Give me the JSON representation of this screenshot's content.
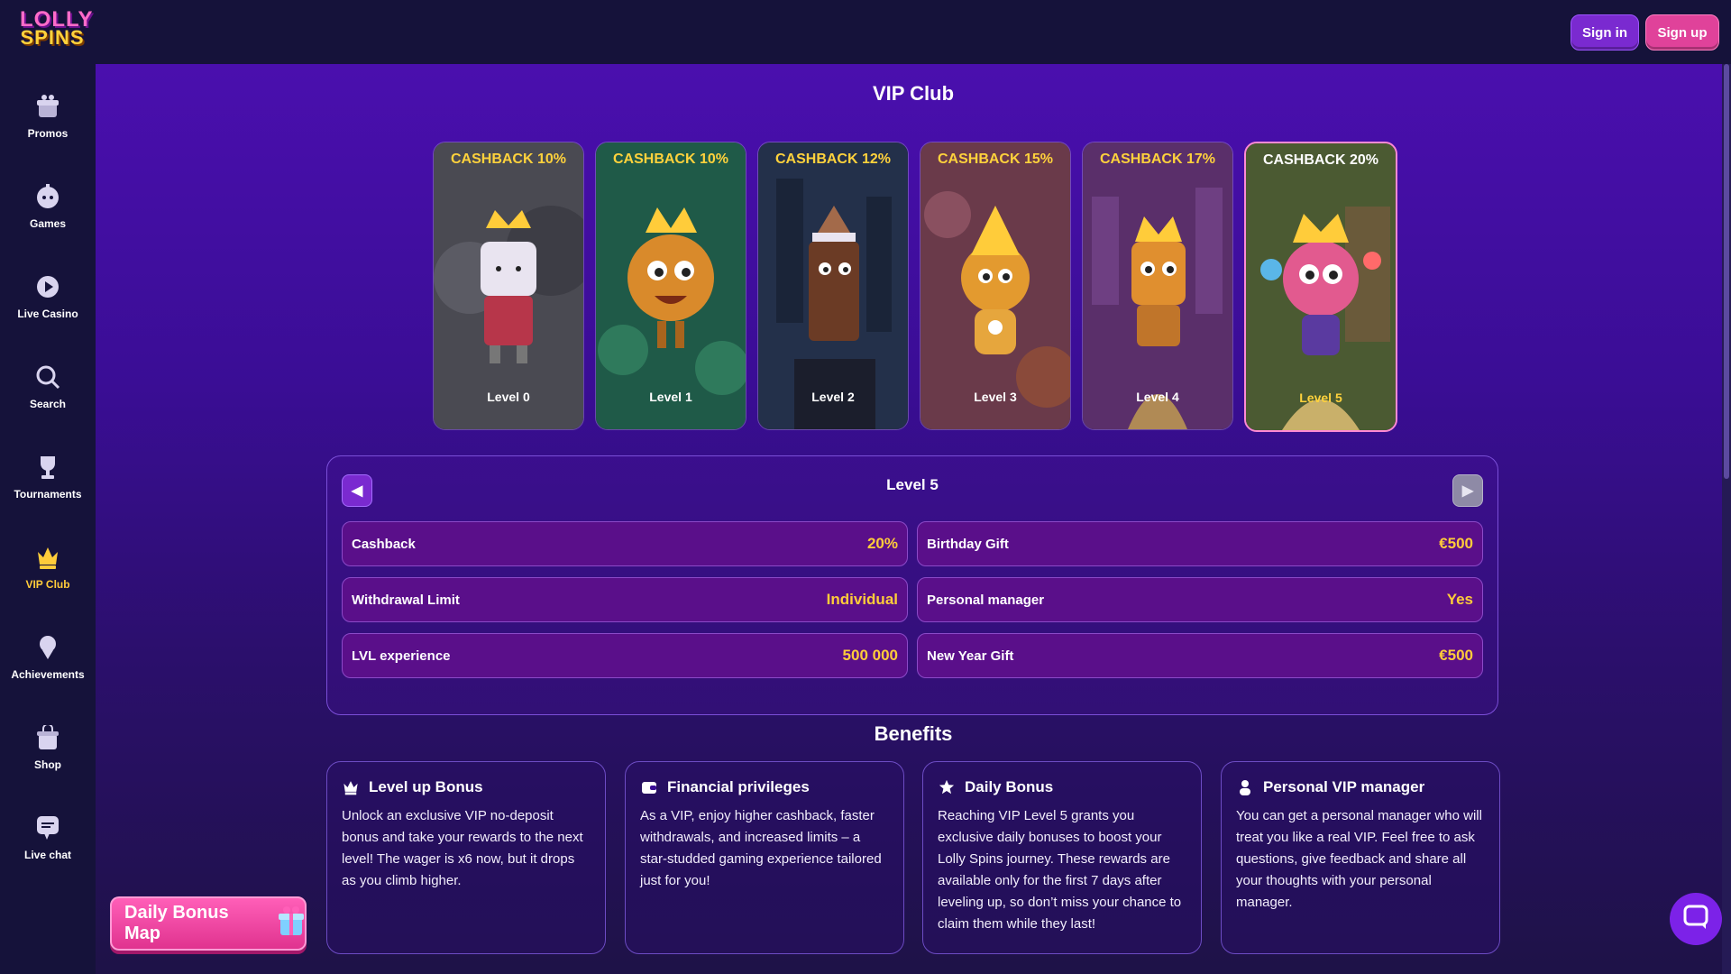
{
  "brand": {
    "line1": "LOLLY",
    "line2": "SPINS"
  },
  "header": {
    "signin_label": "Sign in",
    "signup_label": "Sign up"
  },
  "sidebar": {
    "items": [
      {
        "label": "Promos",
        "icon": "gift-icon"
      },
      {
        "label": "Games",
        "icon": "gamepad-icon"
      },
      {
        "label": "Live Casino",
        "icon": "play-icon"
      },
      {
        "label": "Search",
        "icon": "search-icon"
      },
      {
        "label": "Tournaments",
        "icon": "trophy-icon"
      },
      {
        "label": "VIP Club",
        "icon": "crown-icon",
        "active": true
      },
      {
        "label": "Achievements",
        "icon": "medal-icon"
      },
      {
        "label": "Shop",
        "icon": "shop-icon"
      },
      {
        "label": "Live chat",
        "icon": "chat-icon"
      }
    ]
  },
  "vip": {
    "title": "VIP Club",
    "levels": [
      {
        "cashback": "CASHBACK 10%",
        "label": "Level 0",
        "bg": "#4a4a52"
      },
      {
        "cashback": "CASHBACK 10%",
        "label": "Level 1",
        "bg": "#1f5a48"
      },
      {
        "cashback": "CASHBACK 12%",
        "label": "Level 2",
        "bg": "#23304a"
      },
      {
        "cashback": "CASHBACK 15%",
        "label": "Level 3",
        "bg": "#6a3a4a"
      },
      {
        "cashback": "CASHBACK 17%",
        "label": "Level 4",
        "bg": "#5a2f6a"
      },
      {
        "cashback": "CASHBACK 20%",
        "label": "Level 5",
        "bg": "#4b5a32",
        "active": true
      }
    ],
    "selected_title": "Level 5",
    "stats_left": [
      {
        "key": "Cashback",
        "value": "20%"
      },
      {
        "key": "Withdrawal Limit",
        "value": "Individual"
      },
      {
        "key": "LVL experience",
        "value": "500 000"
      }
    ],
    "stats_right": [
      {
        "key": "Birthday Gift",
        "value": "€500"
      },
      {
        "key": "Personal manager",
        "value": "Yes"
      },
      {
        "key": "New Year Gift",
        "value": "€500"
      }
    ]
  },
  "benefits": {
    "title": "Benefits",
    "cards": [
      {
        "title": "Level up Bonus",
        "icon": "crown-icon",
        "text": "Unlock an exclusive VIP no-deposit bonus and take your rewards to the next level! The wager is x6 now, but it drops as you climb higher."
      },
      {
        "title": "Financial privileges",
        "icon": "wallet-icon",
        "text": "As a VIP, enjoy higher cashback, faster withdrawals, and increased limits – a star-studded gaming experience tailored just for you!"
      },
      {
        "title": "Daily Bonus",
        "icon": "star-icon",
        "text": "Reaching VIP Level 5 grants you exclusive daily bonuses to boost your Lolly Spins journey. These rewards are available only for the first 7 days after leveling up, so don’t miss your chance to claim them while they last!"
      },
      {
        "title": "Personal VIP manager",
        "icon": "person-icon",
        "text": "You can get a personal manager who will treat you like a real VIP. Feel free to ask questions, give feedback and share all your thoughts with your personal manager."
      }
    ]
  },
  "daily_bonus_map": {
    "label": "Daily Bonus Map"
  },
  "colors": {
    "accent": "#ffcc3a",
    "sidebar_bg": "#15123a",
    "main_bg": "#4a0fae",
    "signup": "#e0429a"
  }
}
